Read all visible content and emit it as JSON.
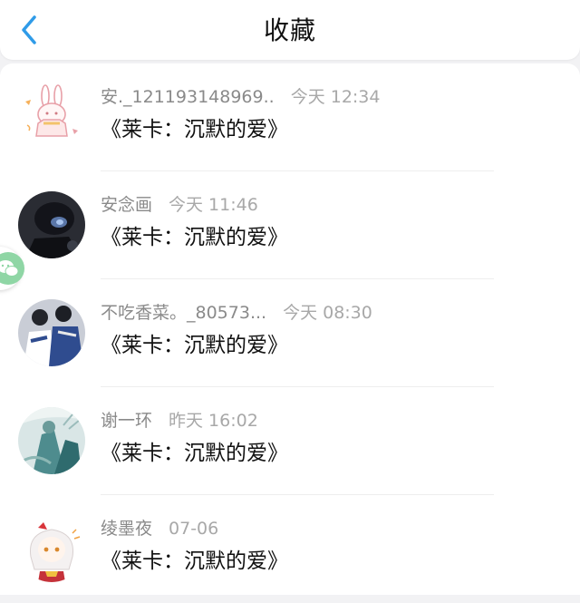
{
  "header": {
    "title": "收藏",
    "back_icon": "chevron-left-icon",
    "accent_color": "#2f9be8"
  },
  "items": [
    {
      "name": "安._121193148969..",
      "time": "今天 12:34",
      "content": "《莱卡：沉默的爱》",
      "avatar": "rabbit-illustration-avatar"
    },
    {
      "name": "安念画",
      "time": "今天 11:46",
      "content": "《莱卡：沉默的爱》",
      "avatar": "dark-figure-photo-avatar"
    },
    {
      "name": "不吃香菜。_80573...",
      "time": "今天 08:30",
      "content": "《莱卡：沉默的爱》",
      "avatar": "two-figures-photo-avatar"
    },
    {
      "name": "谢一环",
      "time": "昨天 16:02",
      "content": "《莱卡：沉默的爱》",
      "avatar": "teal-illustration-avatar"
    },
    {
      "name": "绫墨夜",
      "time": "07-06",
      "content": "《莱卡：沉默的爱》",
      "avatar": "anime-girl-avatar"
    }
  ],
  "floating_button": {
    "icon": "wechat-icon",
    "color": "#8fd6a5"
  }
}
